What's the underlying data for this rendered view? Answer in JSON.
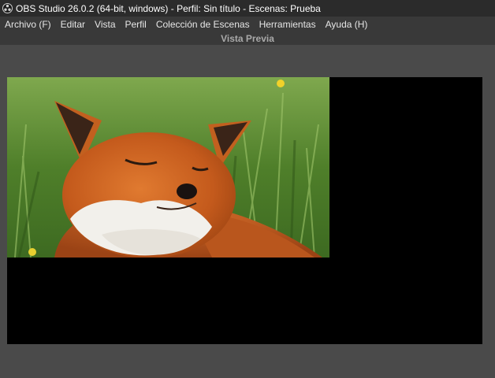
{
  "window": {
    "title": "OBS Studio 26.0.2 (64-bit, windows) - Perfil: Sin título - Escenas: Prueba"
  },
  "menu": {
    "items": [
      {
        "label": "Archivo (F)"
      },
      {
        "label": "Editar"
      },
      {
        "label": "Vista"
      },
      {
        "label": "Perfil"
      },
      {
        "label": "Colección de Escenas"
      },
      {
        "label": "Herramientas"
      },
      {
        "label": "Ayuda (H)"
      }
    ]
  },
  "preview": {
    "label": "Vista Previa"
  },
  "icons": {
    "app": "obs-logo-icon"
  },
  "colors": {
    "titlebar_bg": "#2b2b2b",
    "menubar_bg": "#393939",
    "workspace_bg": "#4a4a4a",
    "canvas_bg": "#000000",
    "preview_label": "#a9a9a9"
  }
}
